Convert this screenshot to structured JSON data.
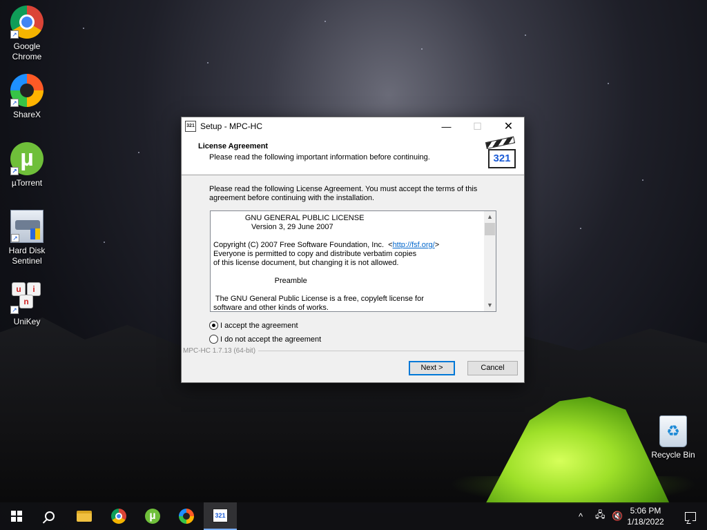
{
  "desktop": {
    "icons": [
      {
        "label": "Google\nChrome",
        "icon": "chrome-icon"
      },
      {
        "label": "ShareX",
        "icon": "sharex-icon"
      },
      {
        "label": "µTorrent",
        "icon": "utorrent-icon"
      },
      {
        "label": "Hard Disk\nSentinel",
        "icon": "hard-disk-sentinel-icon"
      },
      {
        "label": "UniKey",
        "icon": "unikey-icon"
      },
      {
        "label": "Recycle Bin",
        "icon": "recycle-bin-icon"
      }
    ],
    "shortcut_arrow": "↗",
    "utorrent_glyph": "µ",
    "recycle_glyph": "♻",
    "unikey_keys": [
      "u",
      "i",
      "n"
    ]
  },
  "dialog": {
    "title": "Setup - MPC-HC",
    "app_icon_text": "321",
    "window_buttons": {
      "minimize": "—",
      "maximize": "☐",
      "close": "✕"
    },
    "header_title": "License Agreement",
    "header_subtitle": "Please read the following important information before continuing.",
    "logo_text": "321",
    "instructions": "Please read the following License Agreement. You must accept the terms of this agreement before continuing with the installation.",
    "license": {
      "line1": "               GNU GENERAL PUBLIC LICENSE",
      "line2": "                  Version 3, 29 June 2007",
      "line3_prefix": "Copyright (C) 2007 Free Software Foundation, Inc.  <",
      "line3_link": "http://fsf.org/",
      "line3_suffix": ">",
      "line4": "Everyone is permitted to copy and distribute verbatim copies",
      "line5": "of this license document, but changing it is not allowed.",
      "line6": "                             Preamble",
      "line7": " The GNU General Public License is a free, copyleft license for",
      "line8": "software and other kinds of works."
    },
    "scroll_up": "▲",
    "scroll_down": "▼",
    "accept_label": "I accept the agreement",
    "decline_label": "I do not accept the agreement",
    "accept_selected": true,
    "version": "MPC-HC 1.7.13 (64-bit)",
    "next_label": "Next >",
    "cancel_label": "Cancel"
  },
  "taskbar": {
    "items": [
      "start-button",
      "search-button",
      "file-explorer",
      "chrome",
      "utorrent",
      "sharex",
      "mpc-hc-setup"
    ],
    "active": "mpc-hc-setup",
    "tray": {
      "chevron": "^",
      "network": "🖧",
      "volume": "🔇"
    },
    "time": "5:06 PM",
    "date": "1/18/2022",
    "mpc_icon_text": "321"
  },
  "colors": {
    "accent": "#0078d7",
    "link": "#0066cc",
    "tent_green": "#9ee029"
  }
}
